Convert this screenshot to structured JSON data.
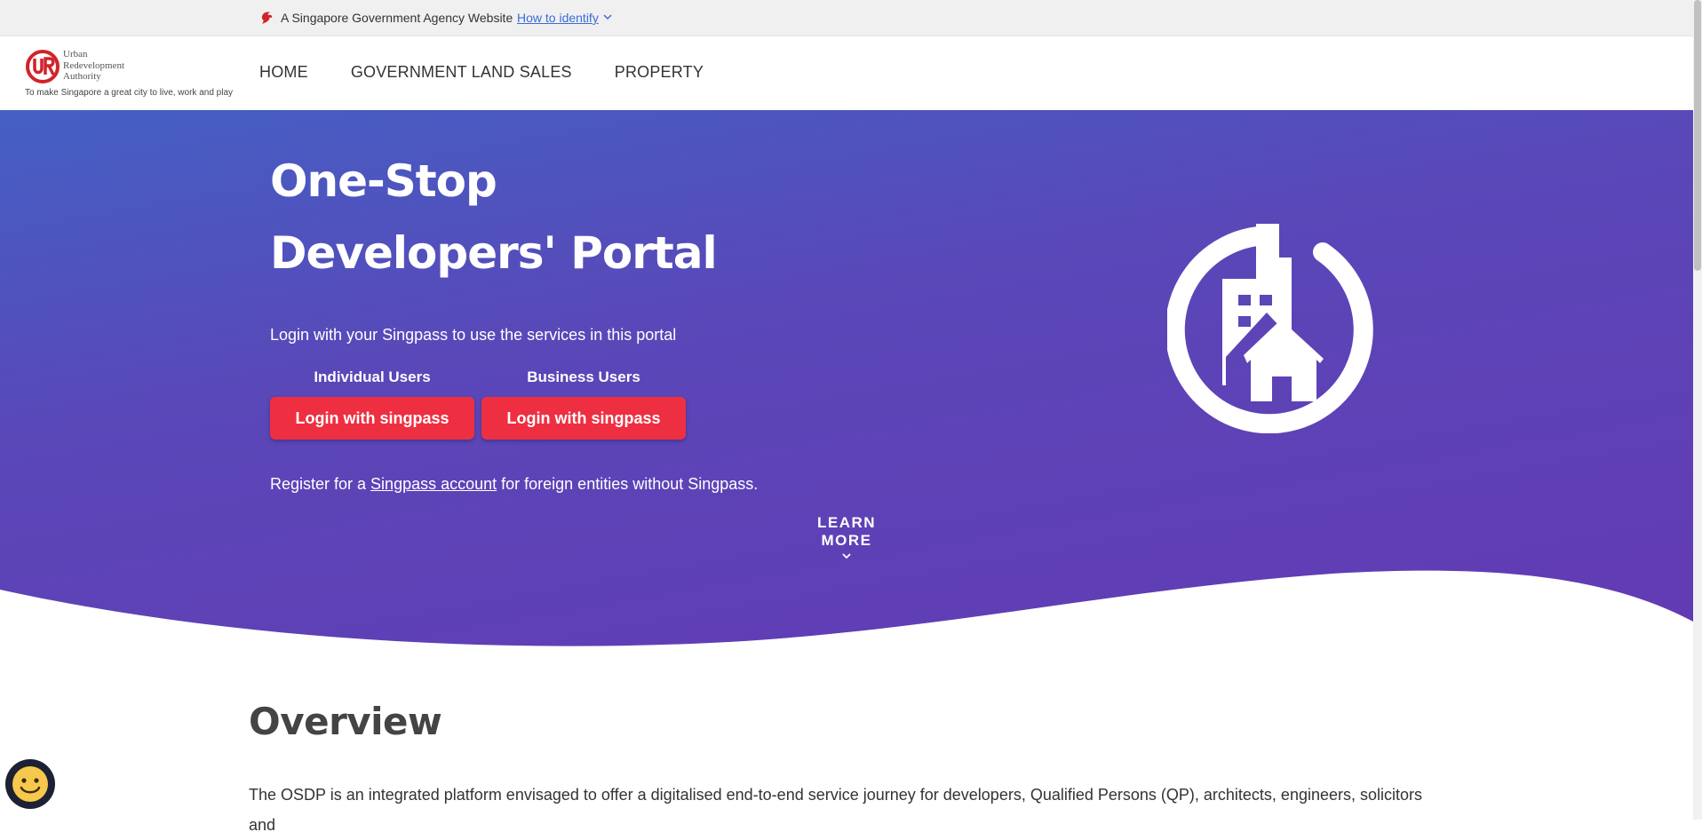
{
  "masthead": {
    "agency_text": "A Singapore Government Agency Website",
    "identify_link": "How to identify"
  },
  "logo": {
    "lines": [
      "Urban",
      "Redevelopment",
      "Authority"
    ],
    "tagline": "To make Singapore a great city to live, work and play"
  },
  "nav": {
    "items": [
      {
        "label": "HOME"
      },
      {
        "label": "GOVERNMENT LAND SALES"
      },
      {
        "label": "PROPERTY"
      }
    ]
  },
  "hero": {
    "title_line1": "One-Stop",
    "title_line2": "Developers' Portal",
    "subtitle": "Login with your Singpass to use the services in this portal",
    "individual_label": "Individual Users",
    "business_label": "Business Users",
    "login_button_label": "Login with singpass",
    "register_prefix": "Register for a ",
    "register_link": "Singpass account",
    "register_suffix": " for foreign entities without Singpass.",
    "learn_more": "LEARN MORE"
  },
  "overview": {
    "title": "Overview",
    "text": "The OSDP is an integrated platform envisaged to offer a digitalised end-to-end service journey for developers, Qualified Persons (QP), architects, engineers, solicitors and"
  },
  "colors": {
    "hero_gradient_start": "#4460c4",
    "hero_gradient_end": "#633ab4",
    "singpass_red": "#ee2f41",
    "ura_red": "#d2232a",
    "link_blue": "#3b6bd6"
  },
  "icons": {
    "masthead": "singapore-lion-icon",
    "building": "building-house-icon",
    "chat": "smiley-chat-icon"
  }
}
